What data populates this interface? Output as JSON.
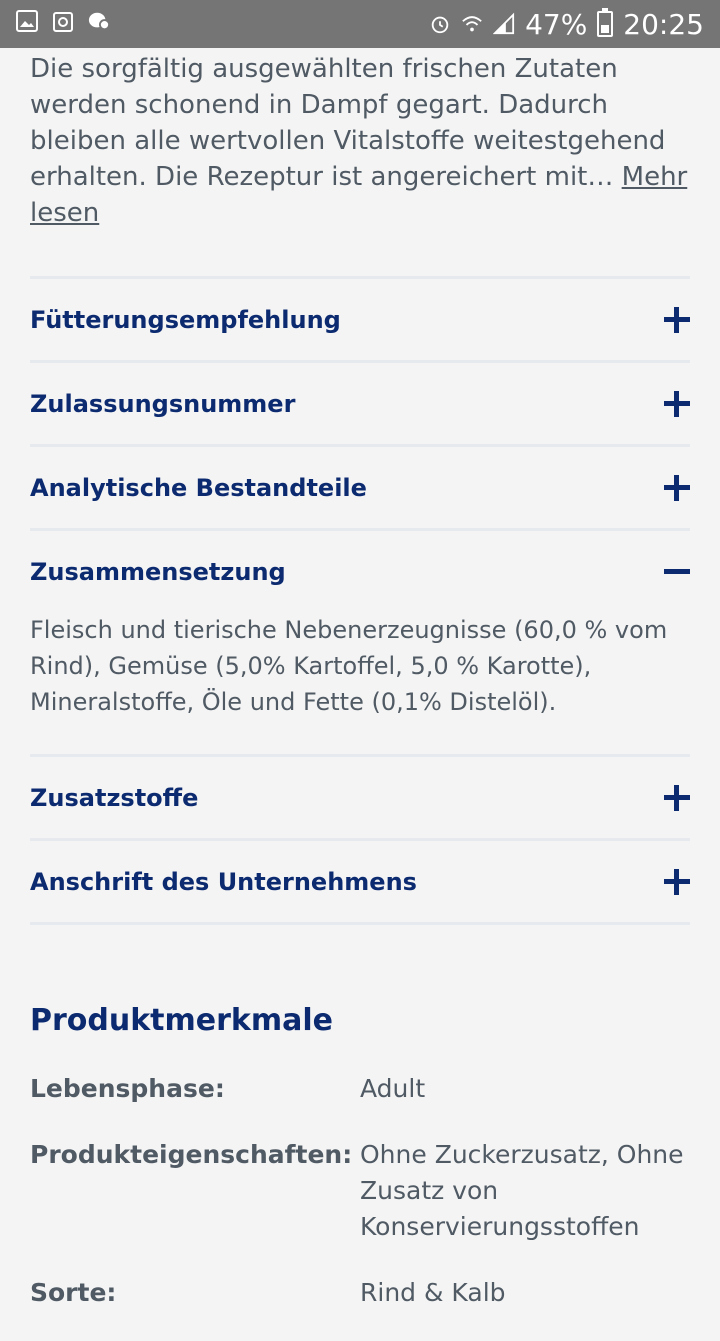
{
  "status_bar": {
    "icons_left": [
      "image-icon",
      "recycle-icon",
      "chat-icon"
    ],
    "alarm_icon": "alarm-icon",
    "wifi_icon": "wifi-icon",
    "signal_icon": "signal-icon",
    "battery_percent": "47%",
    "battery_level": 0.47,
    "time": "20:25"
  },
  "description": {
    "text": "Die sorgfältig ausgewählten frischen Zutaten werden schonend in Dampf gegart. Dadurch bleiben alle wertvollen Vitalstoffe weitestgehend erhalten. Die Rezeptur ist angereichert mit… ",
    "more_label": "Mehr lesen"
  },
  "accordion": {
    "items": [
      {
        "title": "Fütterungsempfehlung",
        "expanded": false
      },
      {
        "title": "Zulassungsnummer",
        "expanded": false
      },
      {
        "title": "Analytische Bestandteile",
        "expanded": false
      },
      {
        "title": "Zusammensetzung",
        "expanded": true,
        "body": "Fleisch und tierische Nebenerzeugnisse (60,0 % vom Rind), Gemüse (5,0% Kartoffel, 5,0 % Karotte), Mineralstoffe, Öle und Fette (0,1% Distelöl)."
      },
      {
        "title": "Zusatzstoffe",
        "expanded": false
      },
      {
        "title": "Anschrift des Unternehmens",
        "expanded": false
      }
    ]
  },
  "product_features": {
    "title": "Produktmerkmale",
    "rows": [
      {
        "label": "Lebensphase:",
        "value": "Adult"
      },
      {
        "label": "Produkteigenschaften:",
        "value": "Ohne Zuckerzusatz, Ohne Zusatz von Konservierungsstoffen"
      },
      {
        "label": "Sorte:",
        "value": "Rind & Kalb"
      }
    ]
  },
  "colors": {
    "accent": "#0b2a6f",
    "text": "#505a64",
    "divider": "#e6e9ee",
    "background": "#f4f4f4",
    "statusbar": "#757575"
  }
}
